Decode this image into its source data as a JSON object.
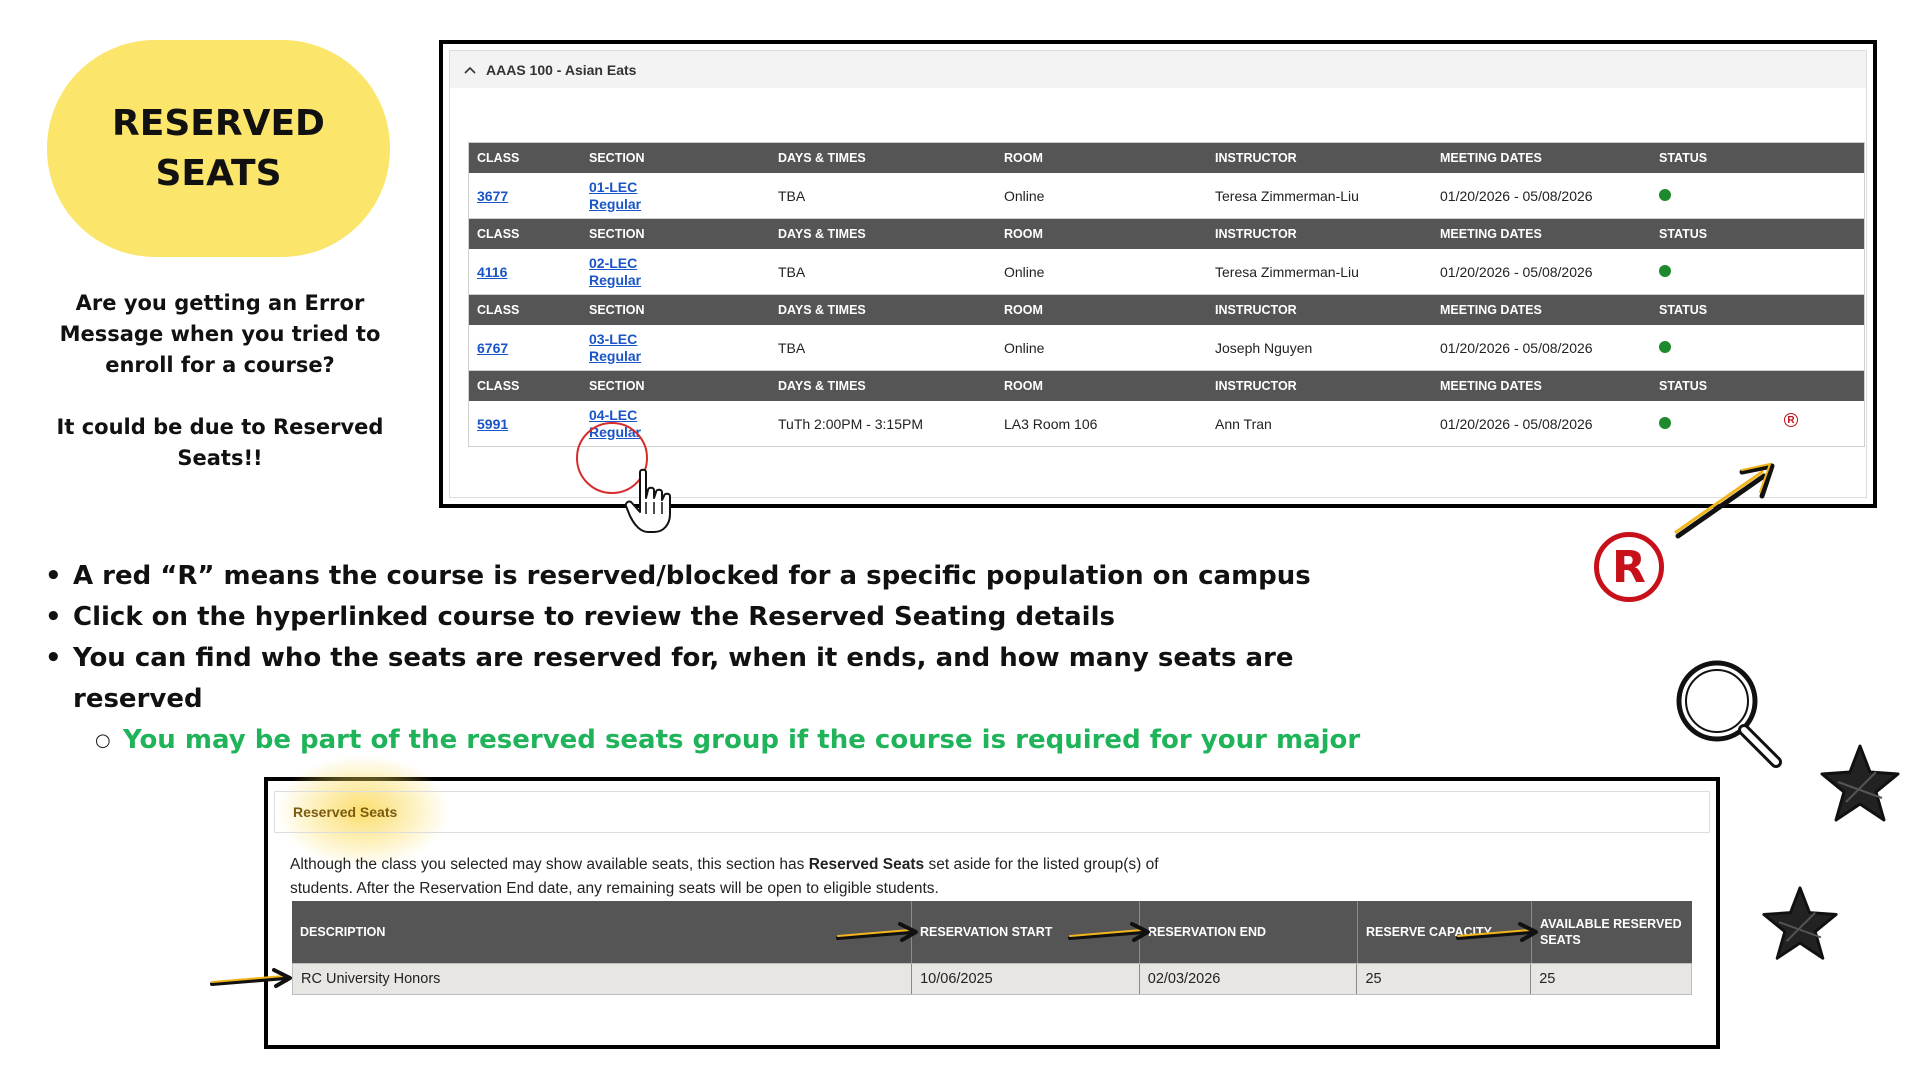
{
  "title_pill": {
    "title": "RESERVED\nSEATS"
  },
  "intro": {
    "p1": "Are you getting an Error Message when you tried to enroll for a course?",
    "p2": "It could be due to Reserved Seats!!"
  },
  "course": {
    "name": "AAAS 100 - Asian Eats",
    "headers": [
      "CLASS",
      "SECTION",
      "DAYS & TIMES",
      "ROOM",
      "INSTRUCTOR",
      "MEETING DATES",
      "STATUS"
    ],
    "rows": [
      {
        "class": "3677",
        "section": "01-LEC",
        "type": "Regular",
        "days": "TBA",
        "room": "Online",
        "instructor": "Teresa Zimmerman-Liu",
        "dates": "01/20/2026 - 05/08/2026"
      },
      {
        "class": "4116",
        "section": "02-LEC",
        "type": "Regular",
        "days": "TBA",
        "room": "Online",
        "instructor": "Teresa Zimmerman-Liu",
        "dates": "01/20/2026 - 05/08/2026"
      },
      {
        "class": "6767",
        "section": "03-LEC",
        "type": "Regular",
        "days": "TBA",
        "room": "Online",
        "instructor": "Joseph Nguyen",
        "dates": "01/20/2026 - 05/08/2026"
      },
      {
        "class": "5991",
        "section": "04-LEC",
        "type": "Regular",
        "days": "TuTh 2:00PM - 3:15PM",
        "room": "LA3  Room 106",
        "instructor": "Ann Tran",
        "dates": "01/20/2026 - 05/08/2026"
      }
    ],
    "reserved_mark": "R",
    "status_color": "#1e8a2e"
  },
  "bullets": {
    "b1": "A red “R” means the course is reserved/blocked for a specific population on campus",
    "b2": "Click on the hyperlinked course to review the Reserved Seating details",
    "b3": "You can find who the seats are reserved for, when it ends, and how many seats are reserved",
    "sub1": "You may be part of the reserved seats group if the course is required for your major"
  },
  "big_r": "R",
  "reserved_seats": {
    "heading": "Reserved Seats",
    "text_before": "Although the class you selected may show available seats, this section has ",
    "text_bold": "Reserved Seats",
    "text_after": " set aside for the listed group(s) of students. After the Reservation End date, any remaining seats will be open to eligible students.",
    "headers": [
      "DESCRIPTION",
      "RESERVATION START",
      "RESERVATION END",
      "RESERVE CAPACITY",
      "AVAILABLE RESERVED SEATS"
    ],
    "row": {
      "description": "RC University Honors",
      "start": "10/06/2025",
      "end": "02/03/2026",
      "capacity": "25",
      "available": "25"
    }
  },
  "colors": {
    "pill": "#fbe56b",
    "table_header": "#555555",
    "reserved_red": "#c8101a",
    "green_text": "#1fb45a",
    "link": "#1a55c8",
    "arrow_yellow": "#f2b61d"
  },
  "icons": [
    "chevron-up-icon",
    "registered-icon",
    "hand-pointer-icon",
    "magnifier-icon",
    "star-doodle-icon",
    "arrow-icon"
  ]
}
